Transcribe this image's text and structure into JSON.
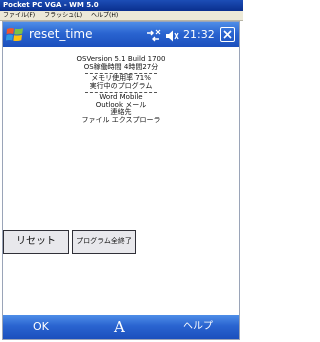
{
  "emulator": {
    "title": "Pocket PC VGA - WM 5.0",
    "menu": [
      "ファイル(F)",
      "フラッシュ(L)",
      "ヘルプ(H)"
    ]
  },
  "navbar": {
    "app_title": "reset_time",
    "clock": "21:32",
    "icons": [
      "windows-start-icon",
      "connectivity-icon",
      "volume-icon",
      "close-icon"
    ]
  },
  "info": {
    "os_version": "OSVersion 5.1  Build 1700",
    "os_uptime": "OS稼働時間 4時間27分",
    "memory": "メモリ使用率 71%",
    "running_header": "実行中のプログラム",
    "programs": [
      "Word Mobile",
      "Outlook メール",
      "連絡先",
      "ファイル エクスプローラ"
    ]
  },
  "buttons": {
    "reset": "リセット",
    "exit_all": "プログラム全終了"
  },
  "softkeys": {
    "left": "OK",
    "sip": "A",
    "right": "ヘルプ"
  },
  "colors": {
    "bar_blue": "#2a64d0",
    "button_face": "#e8e8ec"
  }
}
